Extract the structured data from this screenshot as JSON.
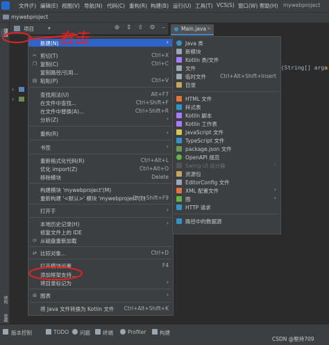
{
  "menubar": {
    "items": [
      "文件(F)",
      "编辑(E)",
      "视图(V)",
      "导航(N)",
      "代码(C)",
      "重构(R)",
      "构建(B)",
      "运行(U)",
      "工具(T)",
      "VCS(S)",
      "窗口(W)",
      "帮助(H)"
    ],
    "project_title": "mywebproject"
  },
  "breadcrumb": {
    "project": "mywebproject"
  },
  "left_stripe": {
    "tab_project": "项目",
    "tab_structure": "结构",
    "tab_favorites": "收藏"
  },
  "project_panel": {
    "title": "项目"
  },
  "editor": {
    "tab_label": "Main.java",
    "code_prefix": "in(String[] arg",
    "code_highlight": "a"
  },
  "annotations": {
    "handwritten": "右击"
  },
  "context_menu": {
    "items": [
      {
        "label": "新建(N)",
        "shortcut": "",
        "submenu": true,
        "selected": true
      },
      {
        "label": "剪切(T)",
        "shortcut": "Ctrl+X"
      },
      {
        "label": "复制(C)",
        "shortcut": "Ctrl+C"
      },
      {
        "label": "复制路径/引用...",
        "shortcut": ""
      },
      {
        "label": "粘贴(P)",
        "shortcut": "Ctrl+V"
      },
      {
        "label": "查找用法(U)",
        "shortcut": "Alt+F7"
      },
      {
        "label": "在文件中查找...",
        "shortcut": "Ctrl+Shift+F"
      },
      {
        "label": "在文件中替换(A)...",
        "shortcut": "Ctrl+Shift+R"
      },
      {
        "label": "分析(Z)",
        "shortcut": "",
        "submenu": true
      },
      {
        "label": "重构(R)",
        "shortcut": "",
        "submenu": true
      },
      {
        "label": "书签",
        "shortcut": "",
        "submenu": true
      },
      {
        "label": "重新格式化代码(R)",
        "shortcut": "Ctrl+Alt+L"
      },
      {
        "label": "优化 import(Z)",
        "shortcut": "Ctrl+Alt+O"
      },
      {
        "label": "移除模块",
        "shortcut": "Delete"
      },
      {
        "label": "构建模块 'mywebproject'(M)",
        "shortcut": ""
      },
      {
        "label": "重新构建 '<默认>' 模块 'mywebproject'(E)",
        "shortcut": "Ctrl+Shift+F9"
      },
      {
        "label": "打开于",
        "shortcut": "",
        "submenu": true
      },
      {
        "label": "本地历史记录(H)",
        "shortcut": "",
        "submenu": true
      },
      {
        "label": "修复文件上的 IDE",
        "shortcut": ""
      },
      {
        "label": "从磁盘重新加载",
        "shortcut": ""
      },
      {
        "label": "比较对象...",
        "shortcut": "Ctrl+D"
      },
      {
        "label": "打开模块设置",
        "shortcut": "F4"
      },
      {
        "label": "添加框架支持...",
        "shortcut": ""
      },
      {
        "label": "将目录标记为",
        "shortcut": "",
        "submenu": true
      },
      {
        "label": "图表",
        "shortcut": "",
        "submenu": true
      },
      {
        "label": "将 Java 文件转换为 Kotlin 文件",
        "shortcut": "Ctrl+Alt+Shift+K"
      }
    ]
  },
  "submenu": {
    "items": [
      {
        "label": "Java 类",
        "shortcut": "",
        "color": "#3592c4"
      },
      {
        "label": "新模块",
        "shortcut": "",
        "color": "#9aa7b0"
      },
      {
        "label": "Kotlin 类/文件",
        "shortcut": "",
        "color": "#a97bff"
      },
      {
        "label": "文件",
        "shortcut": "",
        "color": "#9aa7b0"
      },
      {
        "label": "临时文件",
        "shortcut": "Ctrl+Alt+Shift+Insert",
        "color": "#9aa7b0"
      },
      {
        "label": "目录",
        "shortcut": "",
        "color": "#c9a55b"
      },
      {
        "label": "HTML 文件",
        "shortcut": "",
        "color": "#e5743b"
      },
      {
        "label": "样式表",
        "shortcut": "",
        "color": "#3592c4"
      },
      {
        "label": "Kotlin 脚本",
        "shortcut": "",
        "color": "#a97bff"
      },
      {
        "label": "Kotlin 工作表",
        "shortcut": "",
        "color": "#a97bff"
      },
      {
        "label": "JavaScript 文件",
        "shortcut": "",
        "color": "#d8c84a"
      },
      {
        "label": "TypeScript 文件",
        "shortcut": "",
        "color": "#3592c4"
      },
      {
        "label": "package.json 文件",
        "shortcut": "",
        "color": "#6a9955"
      },
      {
        "label": "OpenAPI 规范",
        "shortcut": "",
        "color": "#62b543"
      },
      {
        "label": "Swing UI 设计器",
        "shortcut": "",
        "color": "#555555",
        "disabled": true,
        "submenu": true
      },
      {
        "label": "资源包",
        "shortcut": "",
        "color": "#c9a55b"
      },
      {
        "label": "EditorConfig 文件",
        "shortcut": "",
        "color": "#9aa7b0"
      },
      {
        "label": "XML 配置文件",
        "shortcut": "",
        "color": "#e5743b",
        "submenu": true
      },
      {
        "label": "图",
        "shortcut": "",
        "color": "#62b543",
        "submenu": true
      },
      {
        "label": "HTTP 请求",
        "shortcut": "",
        "color": "#3592c4"
      },
      {
        "label": "路径中的数据源",
        "shortcut": "",
        "color": "#3592c4"
      }
    ]
  },
  "statusbar": {
    "vcs": "版本控制",
    "todo": "TODO",
    "problems": "问题",
    "terminal": "终端",
    "profiler": "Profiler",
    "build": "构建"
  },
  "watermark": "CSDN @堅持709"
}
